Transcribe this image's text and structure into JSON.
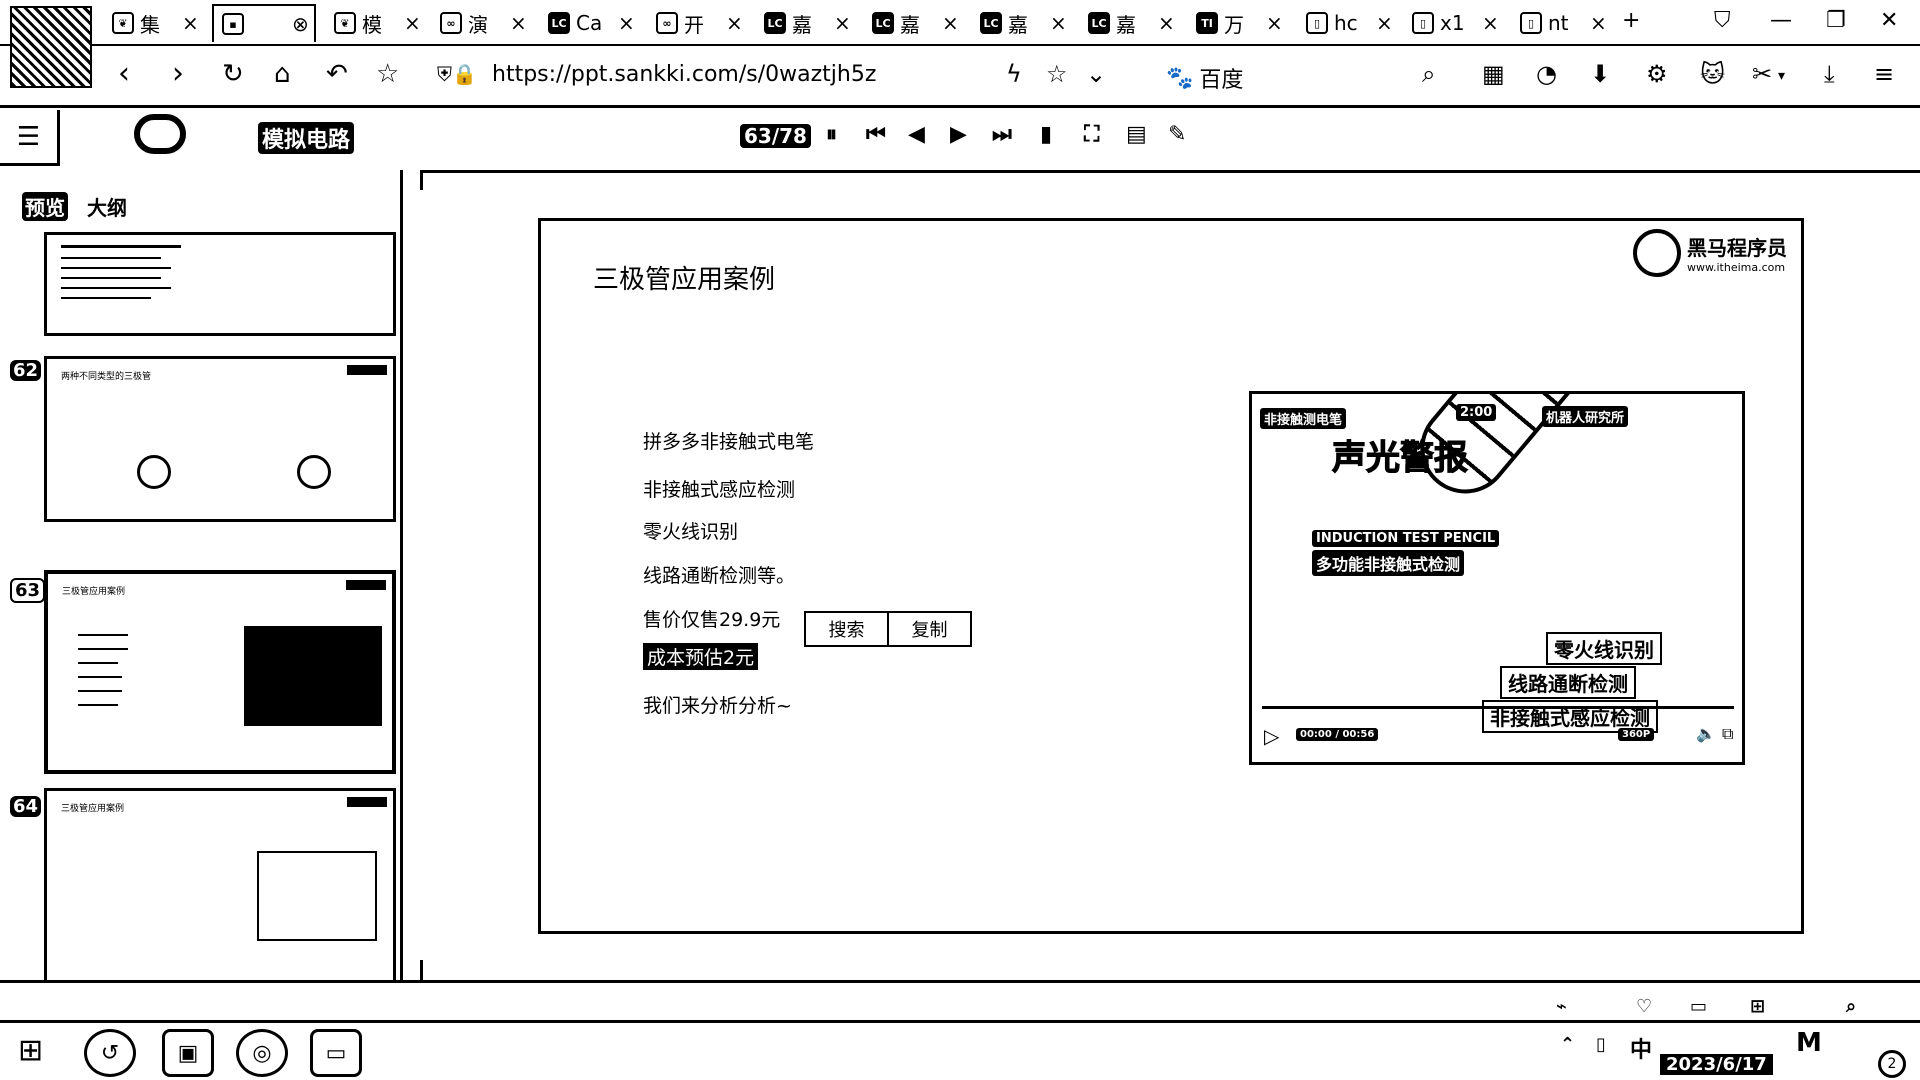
{
  "browser": {
    "tabs": [
      {
        "label": "集",
        "icon": "leaf-icon"
      },
      {
        "label": "",
        "icon": "ppt-icon"
      },
      {
        "label": "模",
        "icon": "leaf-icon"
      },
      {
        "label": "演",
        "icon": "link-icon"
      },
      {
        "label": "Ca",
        "icon": "jlc-icon"
      },
      {
        "label": "开",
        "icon": "link-icon"
      },
      {
        "label": "嘉",
        "icon": "jlc-icon"
      },
      {
        "label": "嘉",
        "icon": "jlc-icon"
      },
      {
        "label": "嘉",
        "icon": "jlc-icon"
      },
      {
        "label": "嘉",
        "icon": "jlc-icon"
      },
      {
        "label": "万",
        "icon": "ti-icon"
      },
      {
        "label": "hc",
        "icon": "doc-icon"
      },
      {
        "label": "x1",
        "icon": "doc-icon"
      },
      {
        "label": "nt",
        "icon": "doc-icon"
      }
    ],
    "url": "https://ppt.sankki.com/s/0waztjh5z",
    "search_engine": "百度"
  },
  "viewer": {
    "doc_title": "模拟电路",
    "page_indicator": "63/78"
  },
  "sidebar": {
    "tabs": [
      "预览",
      "大纲"
    ],
    "thumbnails": [
      {
        "num": "",
        "title": ""
      },
      {
        "num": "62",
        "title": "两种不同类型的三极管"
      },
      {
        "num": "63",
        "title": "三极管应用案例"
      },
      {
        "num": "64",
        "title": "三极管应用案例"
      }
    ]
  },
  "slide": {
    "title": "三极管应用案例",
    "brand_name": "黑马程序员",
    "brand_url": "www.itheima.com",
    "bullets": [
      "拼多多非接触式电笔",
      "非接触式感应检测",
      "零火线识别",
      "线路通断检测等。",
      "售价仅售29.9元"
    ],
    "cost_line": "成本预估2元",
    "closing_line": "我们来分析分析~",
    "popup": {
      "search": "搜索",
      "copy": "复制"
    },
    "video": {
      "tag_top_left": "非接触测电笔",
      "duration": "2:00",
      "tag_top_right": "机器人研究所",
      "headline": "声光警报",
      "subtitle_en": "INDUCTION TEST PENCIL",
      "subtitle_cn": "多功能非接触式检测",
      "feature_1": "零火线识别",
      "feature_2": "线路通断检测",
      "feature_3": "非接触式感应检测",
      "time": "00:00 / 00:56",
      "quality": "360P"
    }
  },
  "taskbar": {
    "ime": "中",
    "date": "2023/6/17",
    "notifications": "2"
  }
}
